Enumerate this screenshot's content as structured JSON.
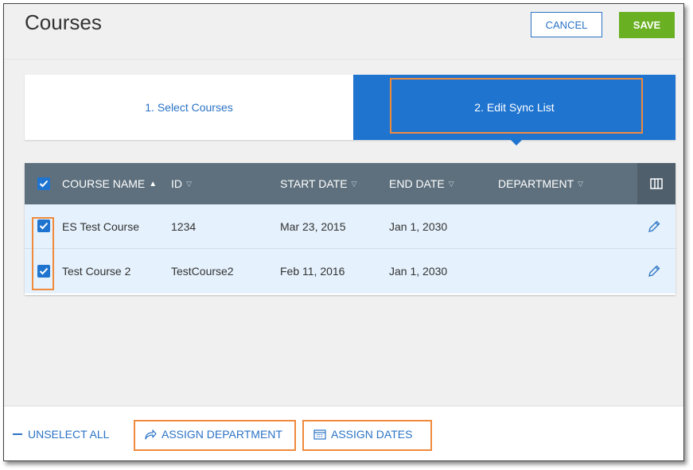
{
  "header": {
    "title": "Courses",
    "cancel_label": "CANCEL",
    "save_label": "SAVE"
  },
  "steps": [
    {
      "label": "1. Select Courses",
      "active": false
    },
    {
      "label": "2. Edit Sync List",
      "active": true
    }
  ],
  "table": {
    "columns": [
      {
        "label": "COURSE NAME",
        "sort": "ascending"
      },
      {
        "label": "ID",
        "sort": "none"
      },
      {
        "label": "START DATE",
        "sort": "none"
      },
      {
        "label": "END DATE",
        "sort": "none"
      },
      {
        "label": "DEPARTMENT",
        "sort": "none"
      }
    ],
    "header_checkbox_checked": true,
    "rows": [
      {
        "checked": true,
        "name": "ES Test Course",
        "id": "1234",
        "start": "Mar 23, 2015",
        "end": "Jan 1, 2030",
        "department": ""
      },
      {
        "checked": true,
        "name": "Test Course 2",
        "id": "TestCourse2",
        "start": "Feb 11, 2016",
        "end": "Jan 1, 2030",
        "department": ""
      }
    ]
  },
  "footer": {
    "unselect_all": "UNSELECT ALL",
    "assign_department": "ASSIGN DEPARTMENT",
    "assign_dates": "ASSIGN DATES"
  },
  "icons": {
    "column-chooser": "columns-icon",
    "edit": "pencil-icon",
    "unselect": "minus-icon",
    "assign-department": "share-arrow-icon",
    "assign-dates": "calendar-icon"
  },
  "colors": {
    "primary": "#1f74d0",
    "link": "#2a73c5",
    "save": "#6ab023",
    "table_header": "#5e707d",
    "highlight": "#f08a3c",
    "row_bg": "#e5f1fc"
  }
}
